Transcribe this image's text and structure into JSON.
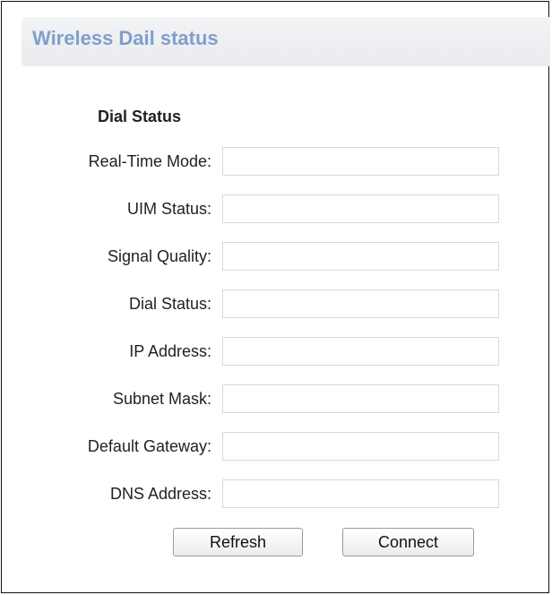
{
  "header": {
    "title": "Wireless Dail status"
  },
  "section": {
    "title": "Dial Status"
  },
  "fields": [
    {
      "label": "Real-Time Mode:",
      "value": ""
    },
    {
      "label": "UIM Status:",
      "value": ""
    },
    {
      "label": "Signal Quality:",
      "value": ""
    },
    {
      "label": "Dial Status:",
      "value": ""
    },
    {
      "label": "IP Address:",
      "value": ""
    },
    {
      "label": "Subnet Mask:",
      "value": ""
    },
    {
      "label": "Default Gateway:",
      "value": ""
    },
    {
      "label": "DNS Address:",
      "value": ""
    }
  ],
  "buttons": {
    "refresh_label": "Refresh",
    "connect_label": "Connect"
  },
  "colors": {
    "title_accent": "#7f9fcb",
    "header_background": "#eceef1",
    "input_border": "#d8d8d8"
  }
}
